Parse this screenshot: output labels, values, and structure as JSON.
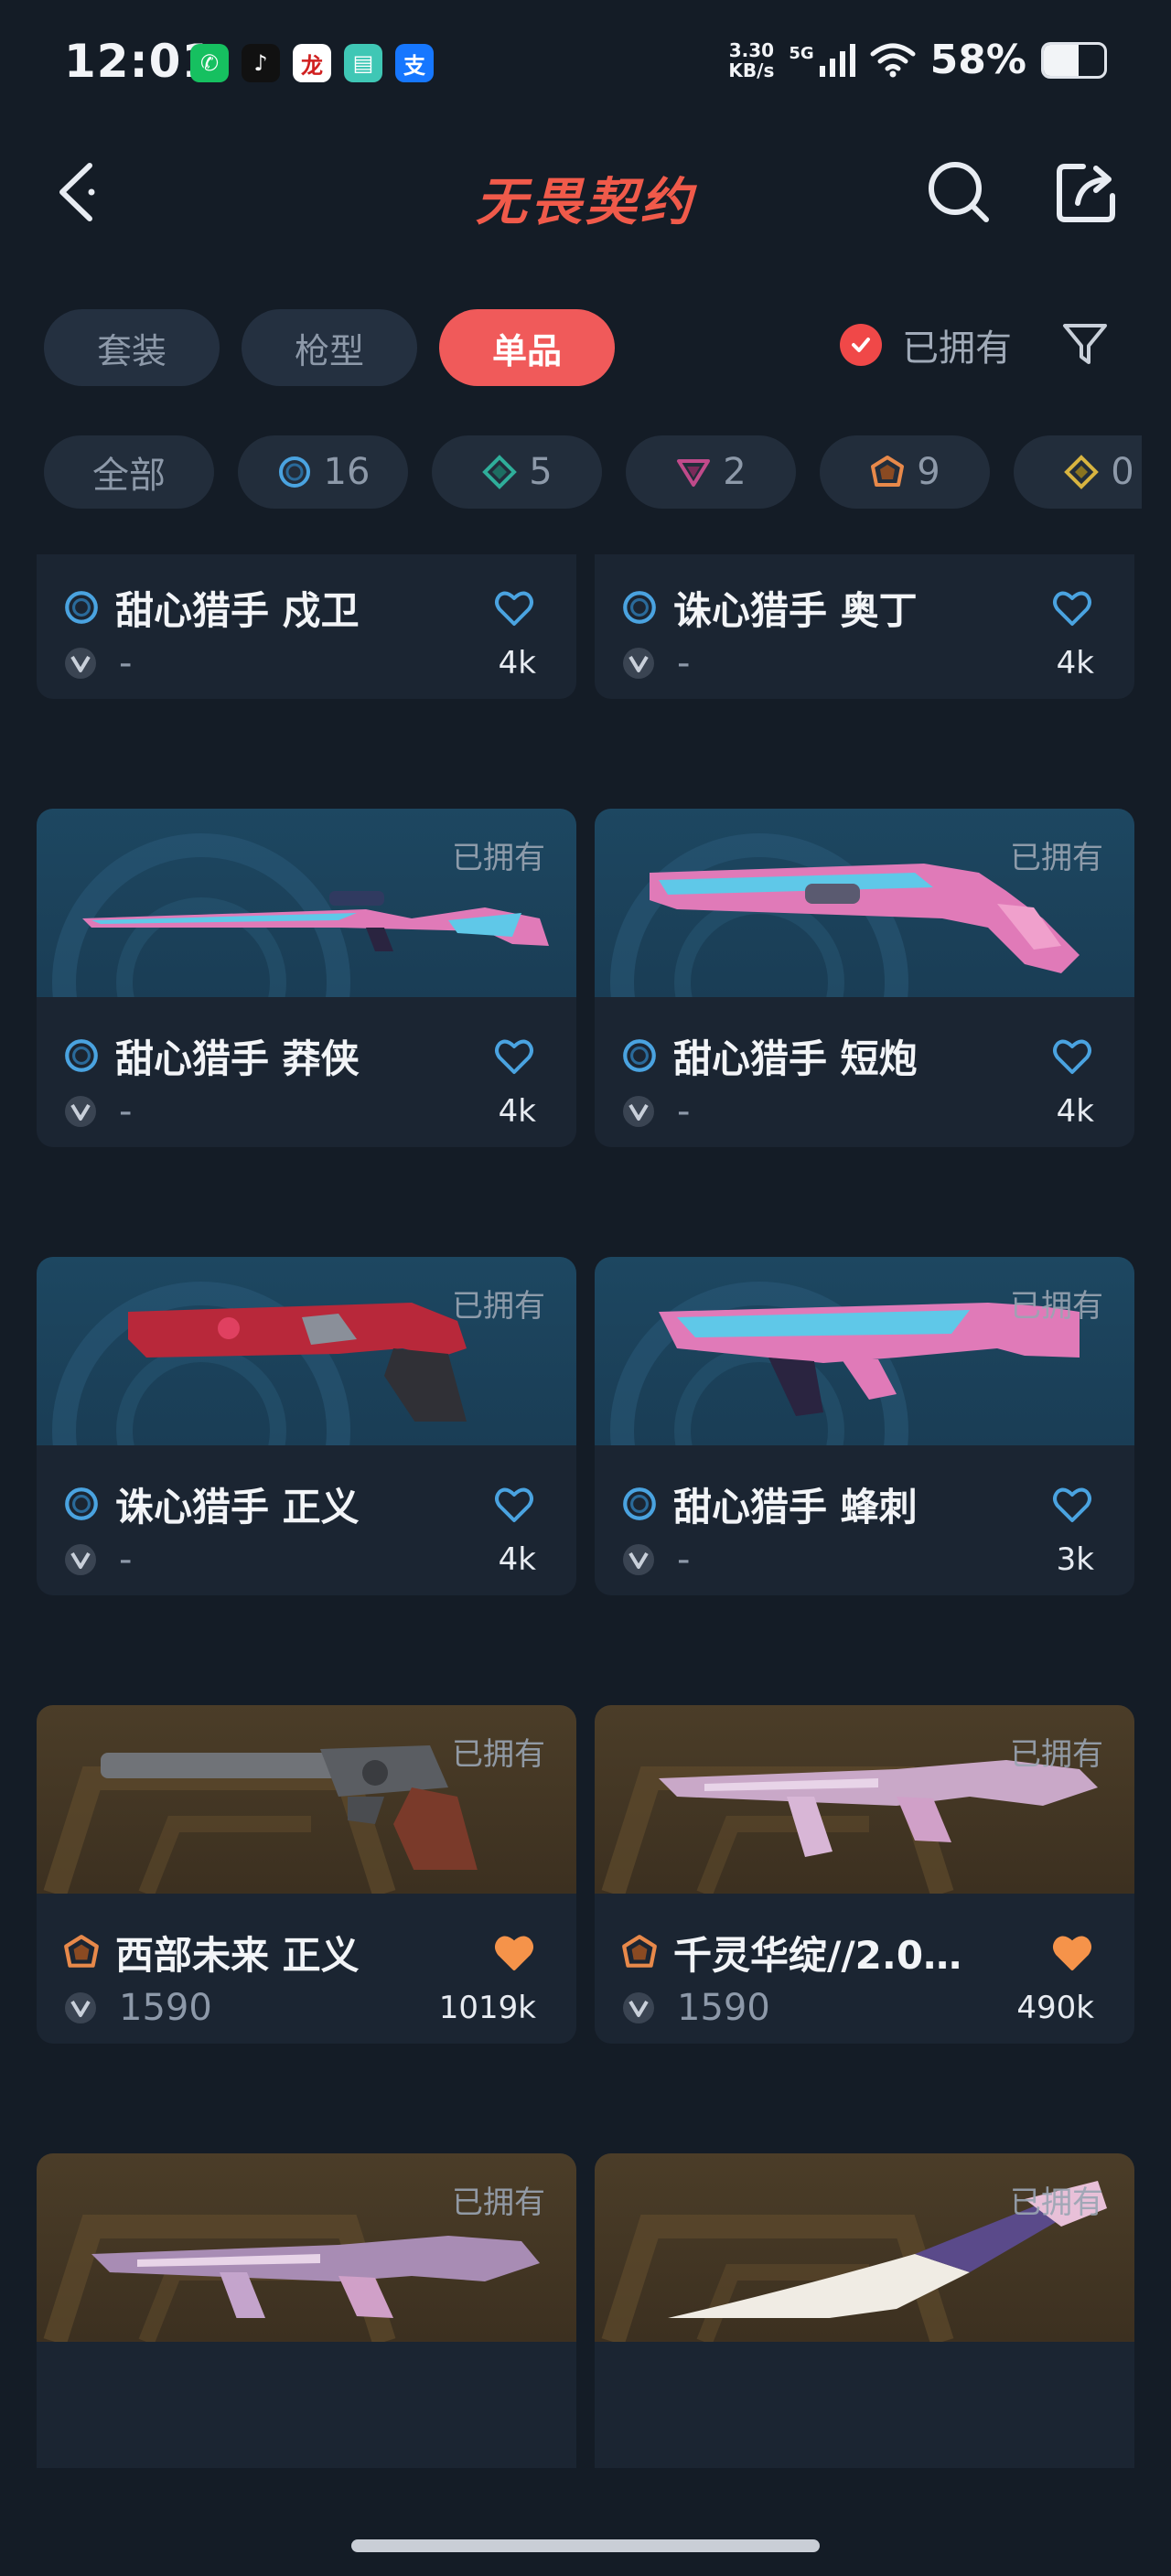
{
  "status_bar": {
    "time": "12:01",
    "speed_value": "3.30",
    "speed_unit": "KB/s",
    "network": "5G",
    "battery_pct": "58%",
    "battery_level": 0.58,
    "apps": [
      {
        "icon": "phone-app-icon",
        "glyph": "✆",
        "color": "#16c060"
      },
      {
        "icon": "tiktok-icon",
        "glyph": "♪",
        "color": "#111111"
      },
      {
        "icon": "calligraphy-app-icon",
        "glyph": "龙",
        "color": "#ffffff"
      },
      {
        "icon": "notes-app-icon",
        "glyph": "▤",
        "color": "#3fc7b5"
      },
      {
        "icon": "alipay-icon",
        "glyph": "支",
        "color": "#1677ff"
      }
    ]
  },
  "header": {
    "title": "无畏契约",
    "title_color": "#f05a4a"
  },
  "tabs": [
    {
      "label": "套装",
      "active": false
    },
    {
      "label": "枪型",
      "active": false
    },
    {
      "label": "单品",
      "active": true
    }
  ],
  "owned_filter": {
    "label": "已拥有",
    "checked": true,
    "check_color": "#f04848"
  },
  "tier_chips": [
    {
      "label": "全部",
      "icon": null
    },
    {
      "label": "16",
      "icon": "select-tier-icon"
    },
    {
      "label": "5",
      "icon": "deluxe-tier-icon"
    },
    {
      "label": "2",
      "icon": "premium-tier-icon"
    },
    {
      "label": "9",
      "icon": "exclusive-tier-icon"
    },
    {
      "label": "0",
      "icon": "ultra-tier-icon"
    }
  ],
  "items": [
    {
      "name": "甜心猎手 戍卫",
      "tier": "select",
      "price": "-",
      "likes": "4k",
      "owned": false,
      "owned_label": "",
      "bg": "blue",
      "weapon": "rifle-pink",
      "heart_filled": false
    },
    {
      "name": "诛心猎手 奥丁",
      "tier": "select",
      "price": "-",
      "likes": "4k",
      "owned": false,
      "owned_label": "",
      "bg": "blue",
      "weapon": "heavy-red",
      "heart_filled": false
    },
    {
      "name": "甜心猎手 莽侠",
      "tier": "select",
      "price": "-",
      "likes": "4k",
      "owned": true,
      "owned_label": "已拥有",
      "bg": "blue",
      "weapon": "sniper-pink",
      "heart_filled": false
    },
    {
      "name": "甜心猎手 短炮",
      "tier": "select",
      "price": "-",
      "likes": "4k",
      "owned": true,
      "owned_label": "已拥有",
      "bg": "blue",
      "weapon": "shotgun-pink",
      "heart_filled": false
    },
    {
      "name": "诛心猎手 正义",
      "tier": "select",
      "price": "-",
      "likes": "4k",
      "owned": true,
      "owned_label": "已拥有",
      "bg": "blue",
      "weapon": "revolver-red",
      "heart_filled": false
    },
    {
      "name": "甜心猎手 蜂刺",
      "tier": "select",
      "price": "-",
      "likes": "3k",
      "owned": true,
      "owned_label": "已拥有",
      "bg": "blue",
      "weapon": "smg-pink",
      "heart_filled": false
    },
    {
      "name": "西部未来 正义",
      "tier": "exclusive",
      "price": "1590",
      "likes": "1019k",
      "owned": true,
      "owned_label": "已拥有",
      "bg": "gold",
      "weapon": "revolver-western",
      "heart_filled": true
    },
    {
      "name": "千灵华绽//2.0…",
      "tier": "exclusive",
      "price": "1590",
      "likes": "490k",
      "owned": true,
      "owned_label": "已拥有",
      "bg": "gold",
      "weapon": "rifle-petal",
      "heart_filled": true
    },
    {
      "name": "",
      "tier": "exclusive",
      "price": "",
      "likes": "",
      "owned": true,
      "owned_label": "已拥有",
      "bg": "gold",
      "weapon": "rifle-petal-2",
      "heart_filled": false
    },
    {
      "name": "",
      "tier": "exclusive",
      "price": "",
      "likes": "",
      "owned": true,
      "owned_label": "已拥有",
      "bg": "gold",
      "weapon": "knife-petal",
      "heart_filled": false
    }
  ],
  "colors": {
    "accent": "#f05a5a",
    "select_tier": "#4aa3e0",
    "exclusive_tier": "#e8894a",
    "heart_outline": "#4aa3e0",
    "heart_filled": "#f5934a"
  }
}
